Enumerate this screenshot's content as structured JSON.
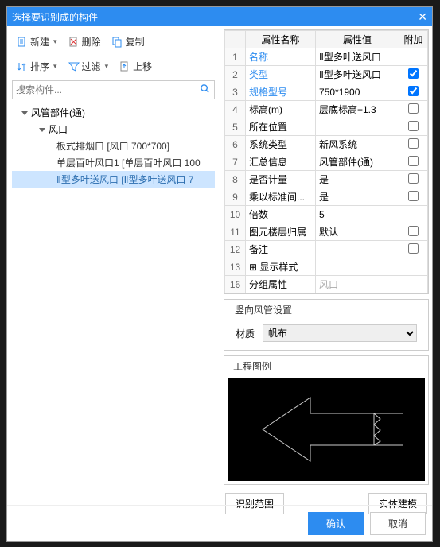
{
  "title": "选择要识别成的构件",
  "toolbar": {
    "new": "新建",
    "delete": "删除",
    "copy": "复制",
    "sort": "排序",
    "filter": "过滤",
    "up": "上移"
  },
  "search": {
    "placeholder": "搜索构件..."
  },
  "tree": {
    "root": "风管部件(通)",
    "child": "风口",
    "items": [
      "板式排烟口 [风口 700*700]",
      "单层百叶风口1 [单层百叶风口 100",
      "Ⅱ型多叶送风口 [Ⅱ型多叶送风口 7"
    ]
  },
  "grid": {
    "headers": {
      "name": "属性名称",
      "value": "属性值",
      "extra": "附加"
    },
    "rows": [
      {
        "n": "1",
        "name": "名称",
        "value": "Ⅱ型多叶送风口",
        "chk": "",
        "blue": true
      },
      {
        "n": "2",
        "name": "类型",
        "value": "Ⅱ型多叶送风口",
        "chk": "on",
        "blue": true
      },
      {
        "n": "3",
        "name": "规格型号",
        "value": "750*1900",
        "chk": "on",
        "blue": true
      },
      {
        "n": "4",
        "name": "标高(m)",
        "value": "层底标高+1.3",
        "chk": "off"
      },
      {
        "n": "5",
        "name": "所在位置",
        "value": "",
        "chk": "off"
      },
      {
        "n": "6",
        "name": "系统类型",
        "value": "新风系统",
        "chk": "off"
      },
      {
        "n": "7",
        "name": "汇总信息",
        "value": "风管部件(通)",
        "chk": "off"
      },
      {
        "n": "8",
        "name": "是否计量",
        "value": "是",
        "chk": "off"
      },
      {
        "n": "9",
        "name": "乘以标准间...",
        "value": "是",
        "chk": "off"
      },
      {
        "n": "10",
        "name": "倍数",
        "value": "5",
        "chk": ""
      },
      {
        "n": "11",
        "name": "图元楼层归属",
        "value": "默认",
        "chk": "off"
      },
      {
        "n": "12",
        "name": "备注",
        "value": "",
        "chk": "off"
      },
      {
        "n": "13",
        "name": "显示样式",
        "value": "",
        "chk": "",
        "expand": true
      },
      {
        "n": "16",
        "name": "分组属性",
        "value": "风口",
        "chk": "",
        "grey": true
      }
    ]
  },
  "vertical": {
    "legend": "竖向风管设置",
    "label": "材质",
    "value": "帆布"
  },
  "preview": {
    "legend": "工程图例"
  },
  "buttons": {
    "range": "识别范围",
    "model": "实体建模",
    "ok": "确认",
    "cancel": "取消"
  }
}
